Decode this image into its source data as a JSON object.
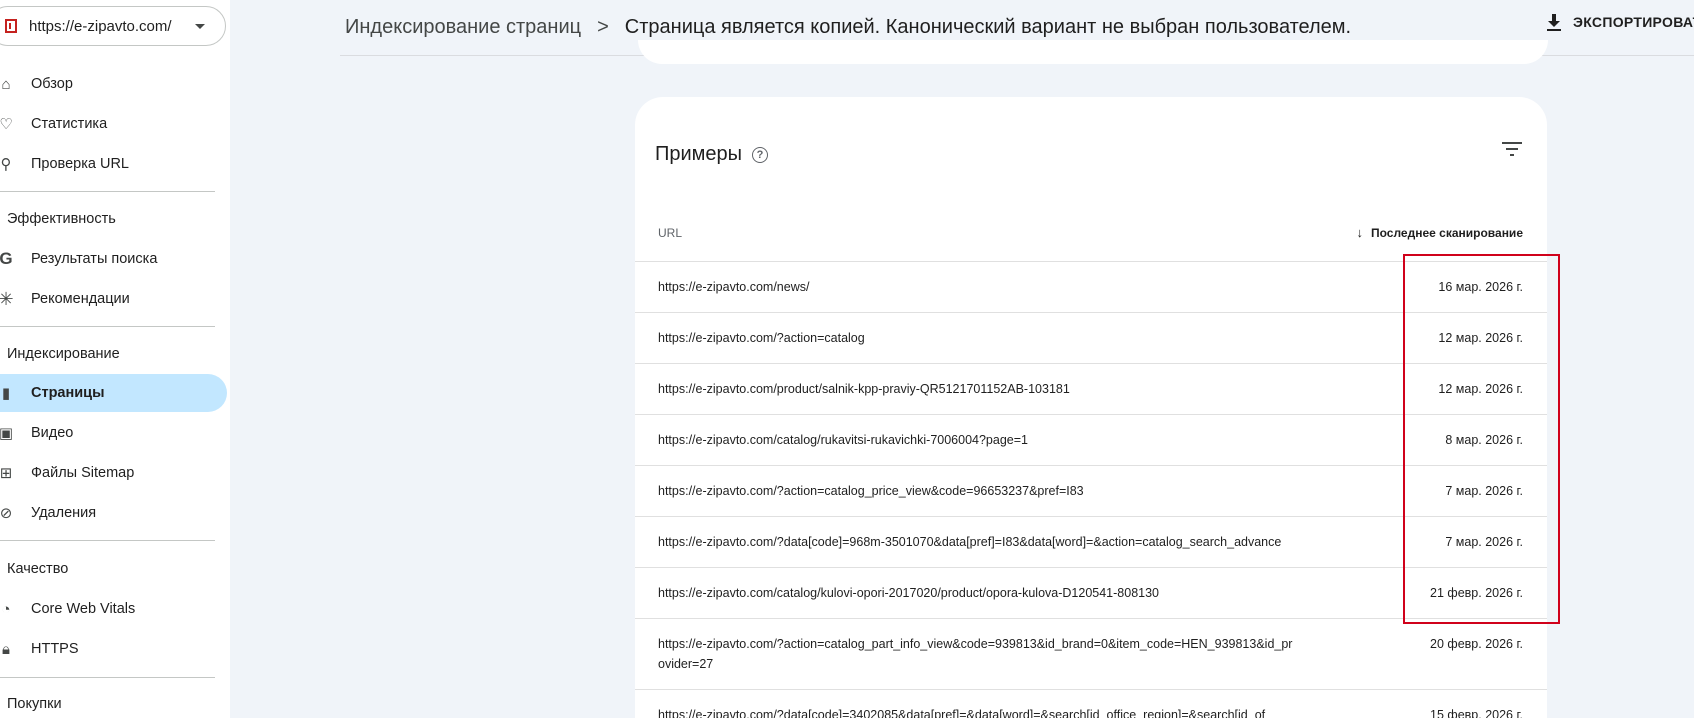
{
  "property": {
    "url": "https://e-zipavto.com/"
  },
  "nav": {
    "overview": "Обзор",
    "stats": "Статистика",
    "url_inspect": "Проверка URL",
    "section_performance": "Эффективность",
    "search_results": "Результаты поиска",
    "recommendations": "Рекомендации",
    "section_indexing": "Индексирование",
    "pages": "Страницы",
    "video": "Видео",
    "sitemaps": "Файлы Sitemap",
    "removals": "Удаления",
    "section_quality": "Качество",
    "cwv": "Core Web Vitals",
    "https": "HTTPS",
    "section_shopping": "Покупки"
  },
  "header": {
    "crumb1": "Индексирование страниц",
    "sep": ">",
    "crumb2": "Страница является копией. Канонический вариант не выбран пользователем.",
    "export": "ЭКСПОРТИРОВАТ"
  },
  "card": {
    "title": "Примеры",
    "col_url": "URL",
    "col_date": "Последнее сканирование",
    "rows": [
      {
        "url": "https://e-zipavto.com/news/",
        "date": "16 мар. 2026 г."
      },
      {
        "url": "https://e-zipavto.com/?action=catalog",
        "date": "12 мар. 2026 г."
      },
      {
        "url": "https://e-zipavto.com/product/salnik-kpp-praviy-QR5121701152AB-103181",
        "date": "12 мар. 2026 г."
      },
      {
        "url": "https://e-zipavto.com/catalog/rukavitsi-rukavichki-7006004?page=1",
        "date": "8 мар. 2026 г."
      },
      {
        "url": "https://e-zipavto.com/?action=catalog_price_view&code=96653237&pref=I83",
        "date": "7 мар. 2026 г."
      },
      {
        "url": "https://e-zipavto.com/?data[code]=968m-3501070&data[pref]=I83&data[word]=&action=catalog_search_advance",
        "date": "7 мар. 2026 г."
      },
      {
        "url": "https://e-zipavto.com/catalog/kulovi-opori-2017020/product/opora-kulova-D120541-808130",
        "date": "21 февр. 2026 г."
      },
      {
        "url": "https://e-zipavto.com/?action=catalog_part_info_view&code=939813&id_brand=0&item_code=HEN_939813&id_provider=27",
        "date": "20 февр. 2026 г."
      },
      {
        "url": "https://e-zipavto.com/?data[code]=3402085&data[pref]=&data[word]=&search[id_office_region]=&search[id_of",
        "date": "15 февр. 2026 г."
      }
    ]
  }
}
